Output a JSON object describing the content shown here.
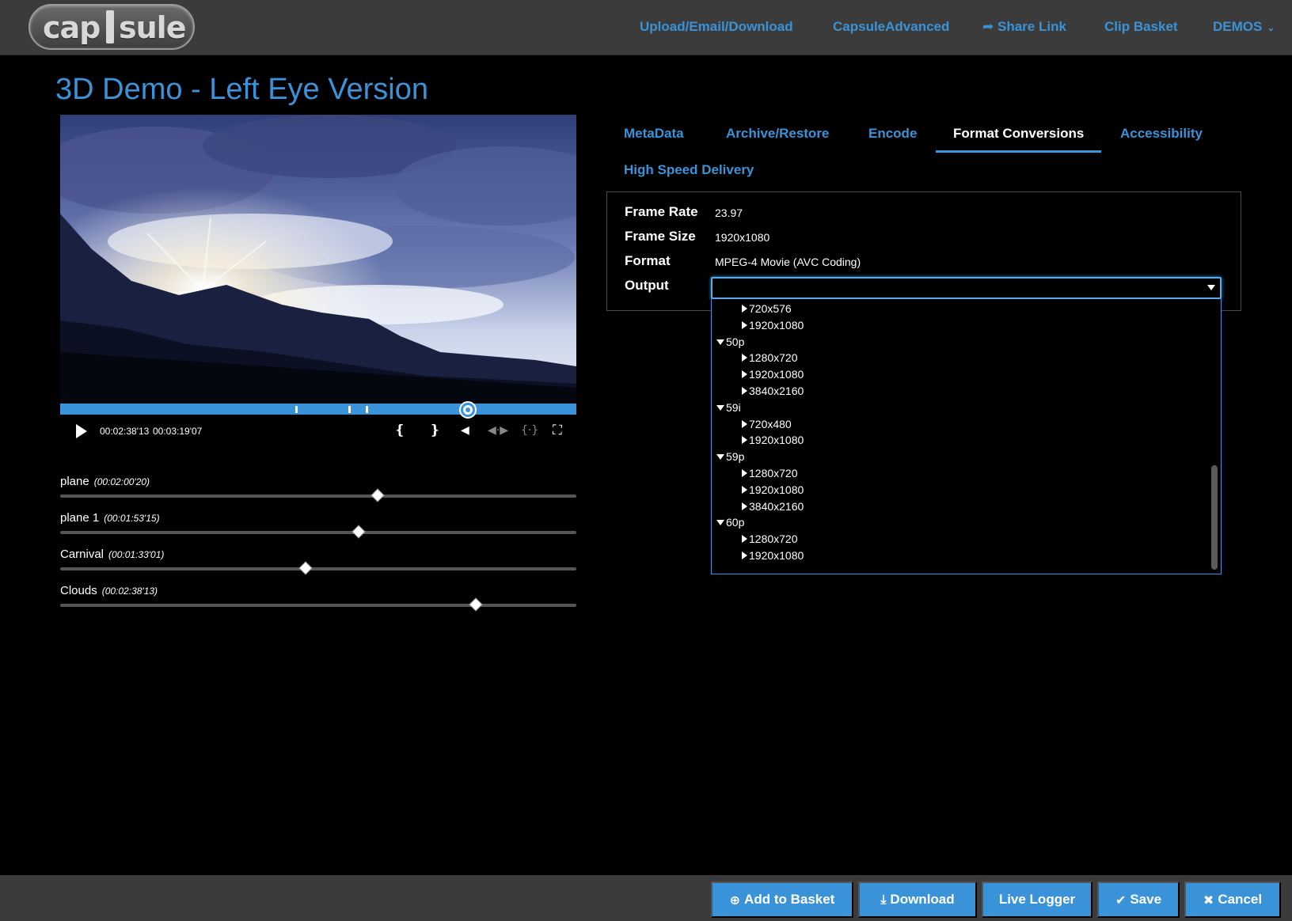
{
  "header": {
    "logo_left": "cap",
    "logo_right": "sule",
    "nav": [
      {
        "label": "Upload/Email/Download"
      },
      {
        "label": "CapsuleAdvanced"
      },
      {
        "label": "Share Link",
        "icon": "share-icon"
      },
      {
        "label": "Clip Basket"
      },
      {
        "label": "DEMOS",
        "icon": "chevron-down-icon"
      }
    ]
  },
  "page": {
    "title": "3D Demo - Left Eye Version"
  },
  "player": {
    "current_time": "00:02:38'13",
    "duration": "00:03:19'07",
    "progress": 0.79
  },
  "markers": [
    {
      "name": "plane",
      "time": "(00:02:00'20)",
      "position": 0.615
    },
    {
      "name": "plane 1",
      "time": "(00:01:53'15)",
      "position": 0.578
    },
    {
      "name": "Carnival",
      "time": "(00:01:33'01)",
      "position": 0.475
    },
    {
      "name": "Clouds",
      "time": "(00:02:38'13)",
      "position": 0.805
    }
  ],
  "tabs": [
    {
      "label": "MetaData"
    },
    {
      "label": "Archive/Restore"
    },
    {
      "label": "Encode"
    },
    {
      "label": "Format Conversions",
      "active": true
    },
    {
      "label": "Accessibility"
    },
    {
      "label": "High Speed Delivery"
    }
  ],
  "properties": {
    "frame_rate_label": "Frame Rate",
    "frame_rate": "23.97",
    "frame_size_label": "Frame Size",
    "frame_size": "1920x1080",
    "format_label": "Format",
    "format": "MPEG-4 Movie (AVC Coding)",
    "output_label": "Output",
    "output_value": ""
  },
  "output_options": [
    {
      "label": "720x576",
      "group": false
    },
    {
      "label": "1920x1080",
      "group": false
    },
    {
      "label": "50p",
      "group": true
    },
    {
      "label": "1280x720",
      "group": false
    },
    {
      "label": "1920x1080",
      "group": false
    },
    {
      "label": "3840x2160",
      "group": false
    },
    {
      "label": "59i",
      "group": true
    },
    {
      "label": "720x480",
      "group": false
    },
    {
      "label": "1920x1080",
      "group": false
    },
    {
      "label": "59p",
      "group": true
    },
    {
      "label": "1280x720",
      "group": false
    },
    {
      "label": "1920x1080",
      "group": false
    },
    {
      "label": "3840x2160",
      "group": false
    },
    {
      "label": "60p",
      "group": true
    },
    {
      "label": "1280x720",
      "group": false
    },
    {
      "label": "1920x1080",
      "group": false
    }
  ],
  "footer": {
    "add_to_basket": "Add to Basket",
    "download": "Download",
    "live_logger": "Live Logger",
    "save": "Save",
    "cancel": "Cancel"
  },
  "colors": {
    "accent": "#3a93d8",
    "bar": "#3b3b3b",
    "background": "#000000"
  }
}
